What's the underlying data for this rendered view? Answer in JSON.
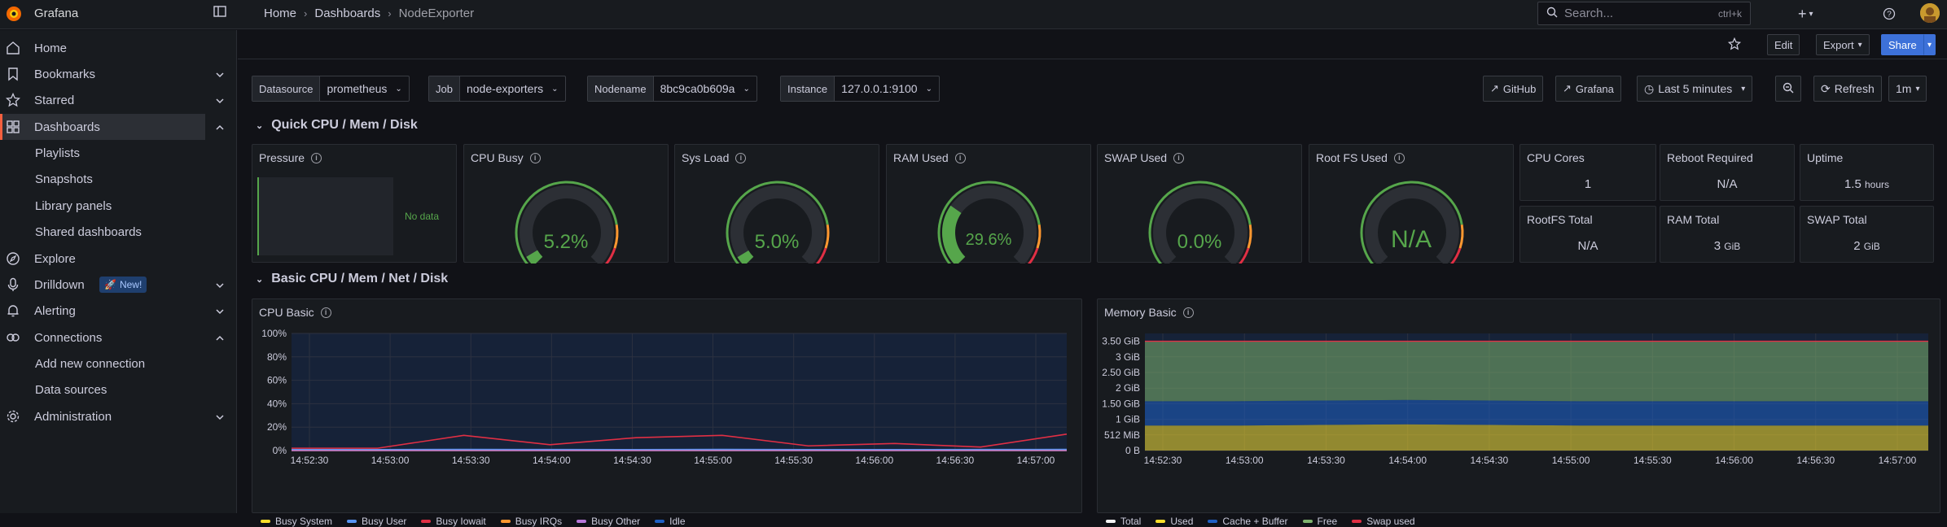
{
  "app": {
    "name": "Grafana"
  },
  "breadcrumbs": [
    "Home",
    "Dashboards",
    "NodeExporter"
  ],
  "search": {
    "placeholder": "Search...",
    "shortcut": "ctrl+k"
  },
  "sidebar": {
    "items": [
      {
        "label": "Home",
        "icon": "home-icon"
      },
      {
        "label": "Bookmarks",
        "icon": "bookmark-icon",
        "expandable": true
      },
      {
        "label": "Starred",
        "icon": "star-icon",
        "expandable": true
      },
      {
        "label": "Dashboards",
        "icon": "apps-icon",
        "expanded": true,
        "active": true
      },
      {
        "label": "Playlists",
        "sub": true
      },
      {
        "label": "Snapshots",
        "sub": true
      },
      {
        "label": "Library panels",
        "sub": true
      },
      {
        "label": "Shared dashboards",
        "sub": true
      },
      {
        "label": "Explore",
        "icon": "compass-icon"
      },
      {
        "label": "Drilldown",
        "icon": "microphone-icon",
        "badge": "New!",
        "expandable": true
      },
      {
        "label": "Alerting",
        "icon": "bell-icon",
        "expandable": true
      },
      {
        "label": "Connections",
        "icon": "link-icon",
        "expanded": true
      },
      {
        "label": "Add new connection",
        "sub": true
      },
      {
        "label": "Data sources",
        "sub": true
      },
      {
        "label": "Administration",
        "icon": "gear-icon",
        "expandable": true
      }
    ]
  },
  "toolbar": {
    "edit": "Edit",
    "export": "Export",
    "share": "Share"
  },
  "variables": [
    {
      "key": "Datasource",
      "value": "prometheus"
    },
    {
      "key": "Job",
      "value": "node-exporters"
    },
    {
      "key": "Nodename",
      "value": "8bc9ca0b609a"
    },
    {
      "key": "Instance",
      "value": "127.0.0.1:9100"
    }
  ],
  "links": {
    "github": "GitHub",
    "grafana": "Grafana"
  },
  "time": {
    "range": "Last 5 minutes",
    "refresh": "Refresh",
    "interval": "1m"
  },
  "rows": {
    "quick": "Quick CPU / Mem / Disk",
    "basic": "Basic CPU / Mem / Net / Disk"
  },
  "panels": {
    "pressure": {
      "title": "Pressure",
      "nodata": "No data"
    },
    "gauges": [
      {
        "title": "CPU Busy",
        "value": "5.2%",
        "percent": 5.2
      },
      {
        "title": "Sys Load",
        "value": "5.0%",
        "percent": 5.0
      },
      {
        "title": "RAM Used",
        "value": "29.6%",
        "percent": 29.6
      },
      {
        "title": "SWAP Used",
        "value": "0.0%",
        "percent": 0
      },
      {
        "title": "Root FS Used",
        "value": "N/A",
        "percent": 0
      }
    ],
    "stats": [
      {
        "title": "CPU Cores",
        "value": "1",
        "unit": ""
      },
      {
        "title": "Reboot Required",
        "value": "N/A",
        "unit": ""
      },
      {
        "title": "Uptime",
        "value": "1.5",
        "unit": "hours"
      },
      {
        "title": "RootFS Total",
        "value": "N/A",
        "unit": ""
      },
      {
        "title": "RAM Total",
        "value": "3",
        "unit": "GiB"
      },
      {
        "title": "SWAP Total",
        "value": "2",
        "unit": "GiB"
      }
    ]
  },
  "colors": {
    "green": "#56a64b",
    "orange": "#ff9830",
    "red": "#e02f44",
    "accent": "#3d71d9"
  },
  "chart_data": [
    {
      "type": "area",
      "title": "CPU Basic",
      "x": [
        "14:52:30",
        "14:53:00",
        "14:53:30",
        "14:54:00",
        "14:54:30",
        "14:55:00",
        "14:55:30",
        "14:56:00",
        "14:56:30",
        "14:57:00"
      ],
      "ylim": [
        0,
        100
      ],
      "yticks": [
        "0%",
        "20%",
        "40%",
        "60%",
        "80%",
        "100%"
      ],
      "series": [
        {
          "name": "Busy System",
          "color": "#fade2a",
          "values": [
            0.5,
            0.5,
            0.6,
            0.5,
            0.5,
            0.6,
            0.5,
            0.5,
            0.5,
            0.7
          ]
        },
        {
          "name": "Busy User",
          "color": "#5794f2",
          "values": [
            0.8,
            0.8,
            1,
            0.9,
            0.8,
            1,
            0.8,
            0.8,
            0.9,
            1
          ]
        },
        {
          "name": "Busy Iowait",
          "color": "#e02f44",
          "values": [
            2,
            2,
            13,
            5,
            11,
            13,
            4,
            6,
            3,
            14
          ]
        },
        {
          "name": "Busy IRQs",
          "color": "#ff9830",
          "values": [
            0,
            0,
            0,
            0,
            0,
            0,
            0,
            0,
            0,
            0
          ]
        },
        {
          "name": "Busy Other",
          "color": "#b877d9",
          "values": [
            0,
            0,
            0,
            0,
            0,
            0,
            0,
            0,
            0,
            0
          ]
        },
        {
          "name": "Idle",
          "color": "#1f60c4",
          "values": [
            97,
            97,
            86,
            94,
            88,
            86,
            95,
            93,
            96,
            85
          ]
        }
      ]
    },
    {
      "type": "area",
      "title": "Memory Basic",
      "x": [
        "14:52:30",
        "14:53:00",
        "14:53:30",
        "14:54:00",
        "14:54:30",
        "14:55:00",
        "14:55:30",
        "14:56:00",
        "14:56:30",
        "14:57:00"
      ],
      "ylim": [
        0,
        3.75
      ],
      "yticks": [
        "0 B",
        "512 MiB",
        "1 GiB",
        "1.50 GiB",
        "2 GiB",
        "2.50 GiB",
        "3 GiB",
        "3.50 GiB"
      ],
      "series": [
        {
          "name": "Total",
          "color": "#f2f2f2",
          "values": [
            3.5,
            3.5,
            3.5,
            3.5,
            3.5,
            3.5,
            3.5,
            3.5,
            3.5,
            3.5
          ]
        },
        {
          "name": "Used",
          "color": "#fade2a",
          "values": [
            0.8,
            0.8,
            0.82,
            0.84,
            0.82,
            0.8,
            0.8,
            0.8,
            0.8,
            0.8
          ]
        },
        {
          "name": "Cache + Buffer",
          "color": "#1f60c4",
          "values": [
            0.78,
            0.78,
            0.78,
            0.78,
            0.78,
            0.78,
            0.78,
            0.78,
            0.78,
            0.78
          ]
        },
        {
          "name": "Free",
          "color": "#7eb26d",
          "values": [
            1.92,
            1.92,
            1.9,
            1.88,
            1.9,
            1.92,
            1.92,
            1.92,
            1.92,
            1.92
          ]
        },
        {
          "name": "Swap used",
          "color": "#e02f44",
          "values": [
            0,
            0,
            0,
            0,
            0,
            0,
            0,
            0,
            0,
            0
          ]
        }
      ]
    }
  ]
}
